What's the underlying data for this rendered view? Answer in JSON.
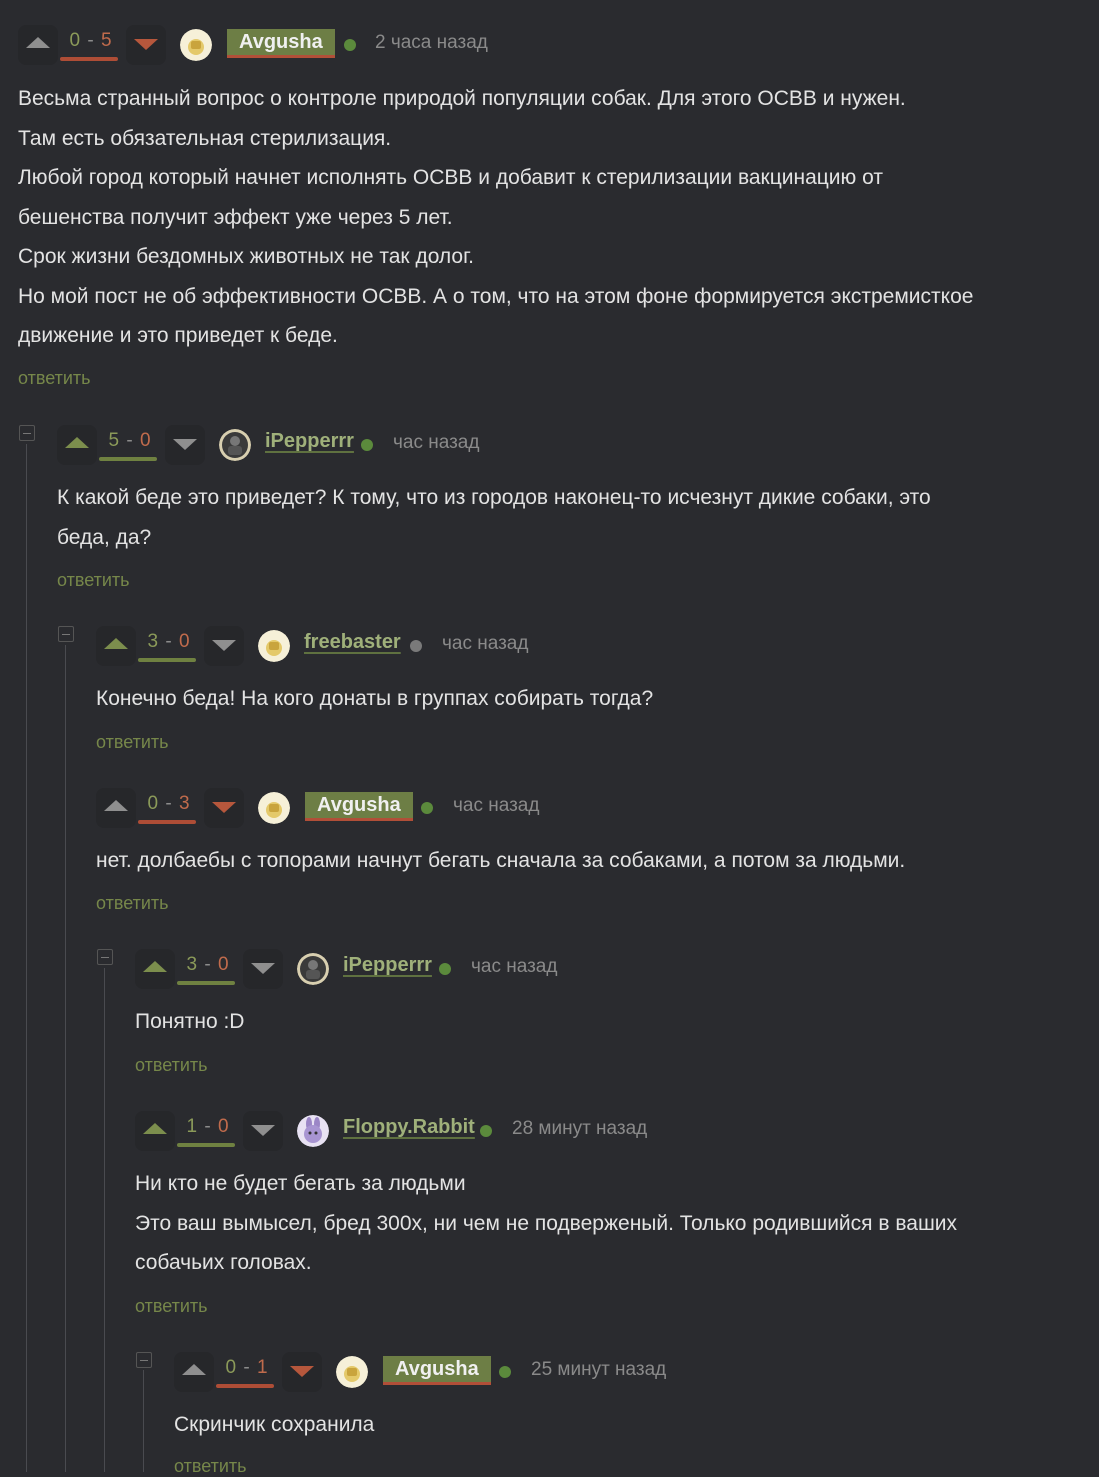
{
  "reply_label": "ответить",
  "comments": [
    {
      "score_plus": "0",
      "score_minus": "5",
      "user": "Avgusha",
      "online": "green",
      "time": "2 часа назад",
      "lines": [
        "Весьма странный вопрос о контроле природой популяции собак. Для этого ОСВВ и нужен.",
        "Там есть обязательная стерилизация.",
        "Любой город который начнет исполнять ОСВВ и добавит к стерилизации вакцинацию от",
        "бешенства получит эффект уже через 5 лет.",
        "Срок жизни бездомных животных не так долог.",
        "Но мой пост не об эффективности ОСВВ. А о том, что на этом фоне формируется экстремисткое",
        "движение и это приведет к беде."
      ]
    },
    {
      "score_plus": "5",
      "score_minus": "0",
      "user": "iPepperrr",
      "online": "green",
      "time": "час назад",
      "lines": [
        "К какой беде это приведет? К тому, что из городов наконец-то исчезнут дикие собаки, это",
        "беда, да?"
      ]
    },
    {
      "score_plus": "3",
      "score_minus": "0",
      "user": "freebaster",
      "online": "gray",
      "time": "час назад",
      "lines": [
        "Конечно беда! На кого донаты в группах собирать тогда?"
      ]
    },
    {
      "score_plus": "0",
      "score_minus": "3",
      "user": "Avgusha",
      "online": "green",
      "time": "час назад",
      "lines": [
        "нет. долбаебы с топорами начнут бегать сначала за собаками, а потом за людьми."
      ]
    },
    {
      "score_plus": "3",
      "score_minus": "0",
      "user": "iPepperrr",
      "online": "green",
      "time": "час назад",
      "lines": [
        "Понятно :D"
      ]
    },
    {
      "score_plus": "1",
      "score_minus": "0",
      "user": "Floppy.Rabbit",
      "online": "green",
      "time": "28 минут назад",
      "lines": [
        "Ни кто не будет бегать за людьми",
        "Это ваш вымысел, бред 300х, ни чем не подверженый. Только родившийся в ваших",
        "собачьих головах."
      ]
    },
    {
      "score_plus": "0",
      "score_minus": "1",
      "user": "Avgusha",
      "online": "green",
      "time": "25 минут назад",
      "lines": [
        "Скринчик сохранила"
      ]
    }
  ],
  "colors": {
    "background": "#2a2b2f",
    "accent_green": "#6d7e45",
    "accent_red": "#b14f38",
    "online_green": "#5b8a3c",
    "offline_gray": "#7a7a7a"
  }
}
